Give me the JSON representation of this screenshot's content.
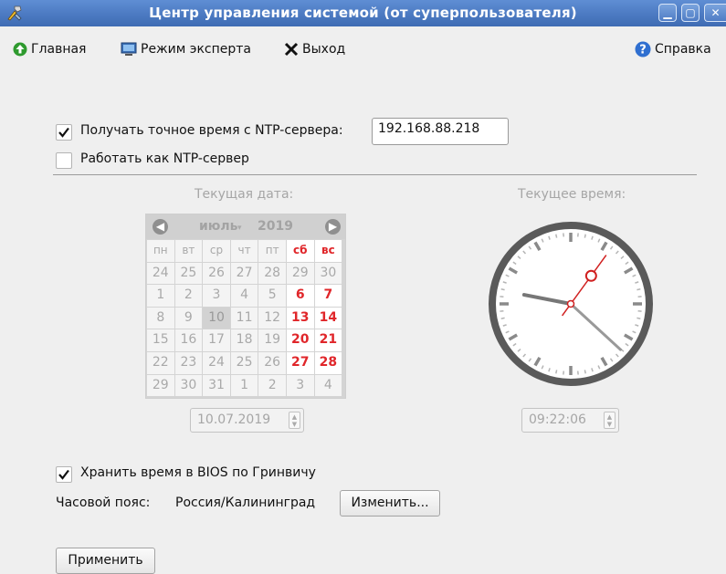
{
  "window": {
    "title": "Центр управления системой (от суперпользователя)",
    "controls": [
      "minimize",
      "maximize",
      "close"
    ]
  },
  "toolbar": {
    "home_label": "Главная",
    "expert_label": "Режим эксперта",
    "exit_label": "Выход",
    "help_label": "Справка"
  },
  "ntp": {
    "sync_label": "Получать точное время с NTP-сервера:",
    "sync_checked": true,
    "server_value": "192.168.88.218",
    "server_label": "Работать как NTP-сервер",
    "server_checked": false
  },
  "date": {
    "label": "Текущая дата:",
    "month": "июль",
    "year": "2019",
    "weekdays": [
      "пн",
      "вт",
      "ср",
      "чт",
      "пт",
      "сб",
      "вс"
    ],
    "weeks": [
      [
        "24",
        "25",
        "26",
        "27",
        "28",
        "29",
        "30"
      ],
      [
        "1",
        "2",
        "3",
        "4",
        "5",
        "6",
        "7"
      ],
      [
        "8",
        "9",
        "10",
        "11",
        "12",
        "13",
        "14"
      ],
      [
        "15",
        "16",
        "17",
        "18",
        "19",
        "20",
        "21"
      ],
      [
        "22",
        "23",
        "24",
        "25",
        "26",
        "27",
        "28"
      ],
      [
        "29",
        "30",
        "31",
        "1",
        "2",
        "3",
        "4"
      ]
    ],
    "selected_day": "10",
    "value": "10.07.2019"
  },
  "time": {
    "label": "Текущее время:",
    "value": "09:22:06",
    "hours": 9,
    "minutes": 22,
    "seconds": 6
  },
  "bios": {
    "label": "Хранить время в BIOS по Гринвичу",
    "checked": true
  },
  "timezone": {
    "label": "Часовой пояс:",
    "value": "Россия/Калининград",
    "change_label": "Изменить..."
  },
  "apply_label": "Применить",
  "colors": {
    "titlebar": "#4a78c0",
    "weekend": "#e0262a",
    "clock_second_hand": "#d02020"
  },
  "icons": {
    "app": "wrench-tools-icon",
    "home": "green-arrow-up-icon",
    "expert": "monitor-icon",
    "exit": "x-icon",
    "help": "question-circle-icon"
  }
}
